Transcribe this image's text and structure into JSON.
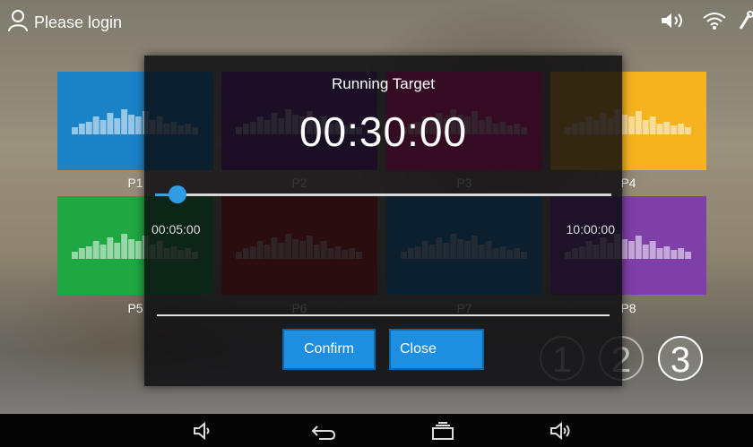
{
  "status_bar": {
    "login_text": "Please login",
    "icons": [
      "user-icon",
      "volume-icon",
      "wifi-icon",
      "key-icon"
    ]
  },
  "programs": [
    {
      "label": "P1",
      "color": "#1a83c8"
    },
    {
      "label": "P2",
      "color": "#6b2f91"
    },
    {
      "label": "P3",
      "color": "#ff1a8c"
    },
    {
      "label": "P4",
      "color": "#f5b41f"
    },
    {
      "label": "P5",
      "color": "#1ea742"
    },
    {
      "label": "P6",
      "color": "#c4221c"
    },
    {
      "label": "P7",
      "color": "#1a83c8"
    },
    {
      "label": "P8",
      "color": "#7f3fa8"
    }
  ],
  "pagination": {
    "pages": [
      "1",
      "2",
      "3"
    ],
    "active": "3"
  },
  "modal": {
    "title": "Running Target",
    "time_value": "00:30:00",
    "slider_min": "00:05:00",
    "slider_max": "10:00:00",
    "slider_fraction": 0.05,
    "confirm_label": "Confirm",
    "close_label": "Close",
    "accent": "#1e8ee0"
  },
  "nav_bar": {
    "icons": [
      "volume-down-icon",
      "back-icon",
      "recent-apps-icon",
      "volume-up-icon"
    ]
  }
}
